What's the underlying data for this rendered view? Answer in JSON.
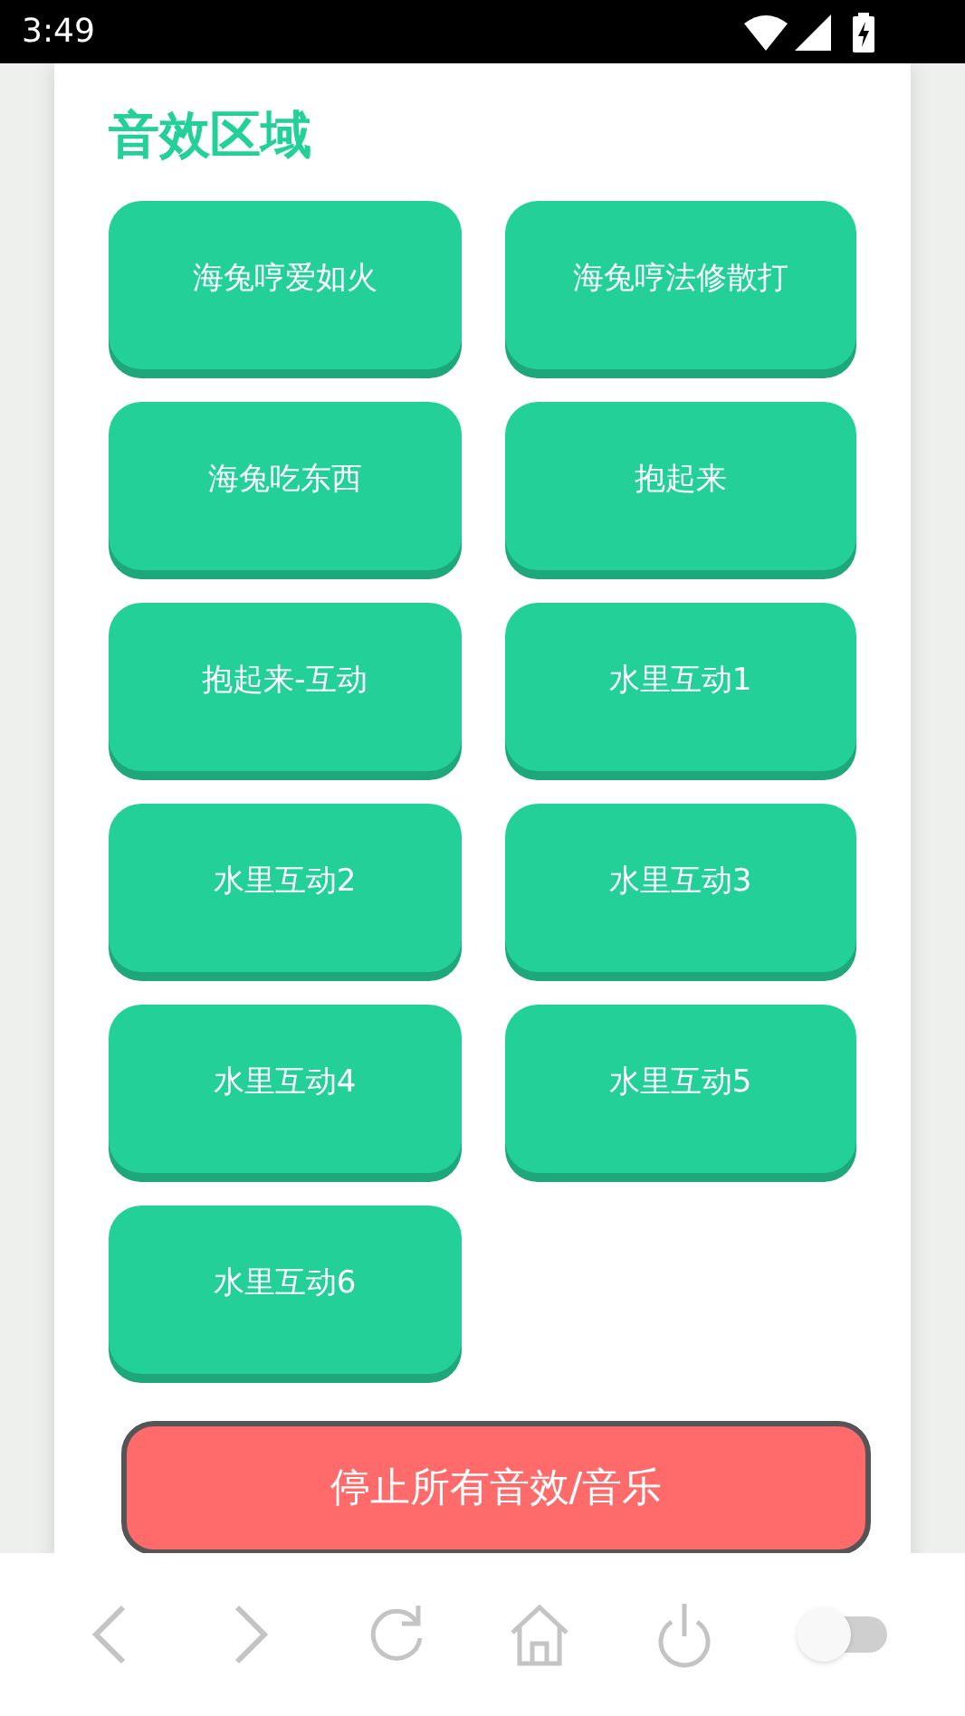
{
  "status_bar": {
    "time": "3:49"
  },
  "section_title": "音效区域",
  "sound_buttons": [
    "海兔哼爱如火",
    "海兔哼法修散打",
    "海兔吃东西",
    "抱起来",
    "抱起来-互动",
    "水里互动1",
    "水里互动2",
    "水里互动3",
    "水里互动4",
    "水里互动5",
    "水里互动6"
  ],
  "stop_button": "停止所有音效/音乐",
  "toolbar": {
    "toggle": {
      "on": false
    }
  }
}
